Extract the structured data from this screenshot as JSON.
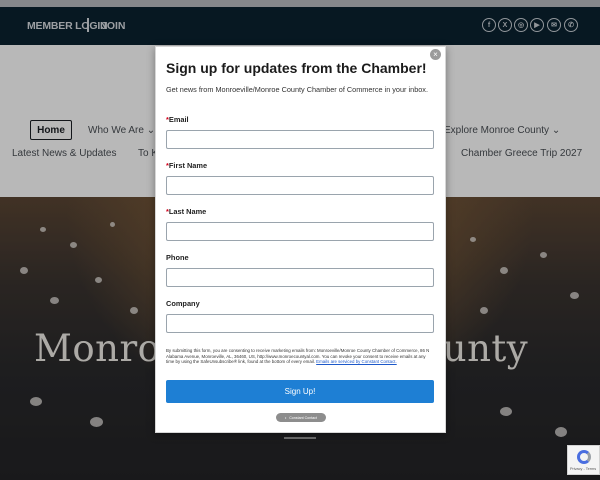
{
  "header": {
    "member_login": "MEMBER LOGIN",
    "join": "JOIN",
    "social_icons": [
      "facebook-icon",
      "x-icon",
      "instagram-icon",
      "youtube-icon",
      "email-icon",
      "whatsapp-icon"
    ]
  },
  "nav": {
    "home": "Home",
    "who_we_are": "Who We Are",
    "explore": "Explore Monroe County",
    "latest_news": "Latest News & Updates",
    "to_partial": "To K",
    "greece_trip": "Chamber Greece Trip 2027"
  },
  "hero": {
    "title_left": "Monro",
    "title_right": "ounty"
  },
  "modal": {
    "title": "Sign up for updates from the Chamber!",
    "subtitle": "Get news from Monroeville/Monroe County Chamber of Commerce in your inbox.",
    "fields": [
      {
        "label": "Email",
        "required": true,
        "value": ""
      },
      {
        "label": "First Name",
        "required": true,
        "value": ""
      },
      {
        "label": "Last Name",
        "required": true,
        "value": ""
      },
      {
        "label": "Phone",
        "required": false,
        "value": ""
      },
      {
        "label": "Company",
        "required": false,
        "value": ""
      }
    ],
    "required_mark": "*",
    "legal_text": "By submitting this form, you are consenting to receive marketing emails from: Monroeville/Monroe County Chamber of Commerce, 86 N Alabama Avenue, Monroeville, AL, 36460, US, http://www.monroecountyal.com. You can revoke your consent to receive emails at any time by using the SafeUnsubscribe® link, found at the bottom of every email.",
    "legal_link": "Emails are serviced by Constant Contact.",
    "submit_label": "Sign Up!",
    "close_symbol": "×",
    "cc_logo": "Constant Contact"
  },
  "recaptcha": {
    "text": "Privacy - Terms"
  },
  "colors": {
    "header_bg": "#0b2230",
    "signup_button": "#1e7fd4",
    "required_star": "#d0021b"
  }
}
